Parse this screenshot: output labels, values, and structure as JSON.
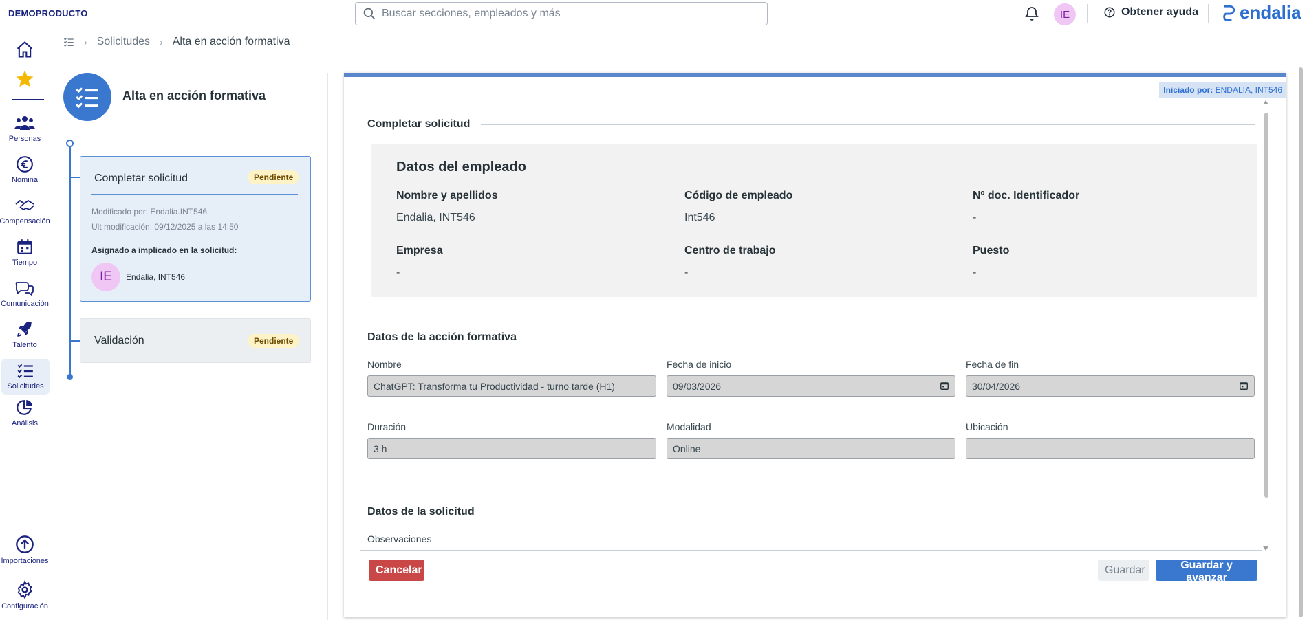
{
  "topbar": {
    "brand": "DEMOPRODUCTO",
    "search_placeholder": "Buscar secciones, empleados y más",
    "avatar_initials": "IE",
    "help_label": "Obtener ayuda",
    "logo_text": "endalia"
  },
  "sidebar": {
    "items": [
      {
        "label": "Personas",
        "icon": "people-icon"
      },
      {
        "label": "Nómina",
        "icon": "euro-icon"
      },
      {
        "label": "Compensación",
        "icon": "handshake-icon"
      },
      {
        "label": "Tiempo",
        "icon": "calendar-icon"
      },
      {
        "label": "Comunicación",
        "icon": "chat-icon"
      },
      {
        "label": "Talento",
        "icon": "rocket-icon"
      },
      {
        "label": "Solicitudes",
        "icon": "checklist-icon"
      },
      {
        "label": "Análisis",
        "icon": "pie-chart-icon"
      },
      {
        "label": "Importaciones",
        "icon": "upload-icon"
      },
      {
        "label": "Configuración",
        "icon": "gear-icon"
      }
    ],
    "active": "Solicitudes"
  },
  "breadcrumb": {
    "parent": "Solicitudes",
    "current": "Alta en acción formativa"
  },
  "workflow": {
    "title": "Alta en acción formativa",
    "steps": [
      {
        "title": "Completar solicitud",
        "status": "Pendiente",
        "modified_by": "Modificado por: Endalia.INT546",
        "last_modified": "Ult modificación: 09/12/2025 a las 14:50",
        "assigned_label": "Asignado a implicado en la solicitud:",
        "assignee_initials": "IE",
        "assignee_name": "Endalia, INT546"
      },
      {
        "title": "Validación",
        "status": "Pendiente"
      }
    ]
  },
  "form": {
    "initiated_label": "Iniciado por:",
    "initiated_value": "ENDALIA, INT546",
    "section_title": "Completar solicitud",
    "employee": {
      "heading": "Datos del empleado",
      "fields": [
        {
          "label": "Nombre y apellidos",
          "value": "Endalia, INT546"
        },
        {
          "label": "Código de empleado",
          "value": "Int546"
        },
        {
          "label": "Nº doc. Identificador",
          "value": "-"
        },
        {
          "label": "Empresa",
          "value": "-"
        },
        {
          "label": "Centro de trabajo",
          "value": "-"
        },
        {
          "label": "Puesto",
          "value": "-"
        }
      ]
    },
    "training": {
      "heading": "Datos de la acción formativa",
      "fields": [
        {
          "label": "Nombre",
          "value": "ChatGPT: Transforma tu Productividad - turno tarde (H1)"
        },
        {
          "label": "Fecha de inicio",
          "value": "09/03/2026"
        },
        {
          "label": "Fecha de fin",
          "value": "30/04/2026"
        },
        {
          "label": "Duración",
          "value": "3 h"
        },
        {
          "label": "Modalidad",
          "value": "Online"
        },
        {
          "label": "Ubicación",
          "value": ""
        }
      ]
    },
    "request": {
      "heading": "Datos de la solicitud",
      "observations_label": "Observaciones"
    },
    "buttons": {
      "cancel": "Cancelar",
      "save": "Guardar",
      "save_advance": "Guardar y avanzar"
    }
  },
  "colors": {
    "accent": "#3a78d0",
    "danger": "#c94747",
    "badge_bg": "#fdf3c7",
    "avatar_bg": "#f0c6f5"
  }
}
